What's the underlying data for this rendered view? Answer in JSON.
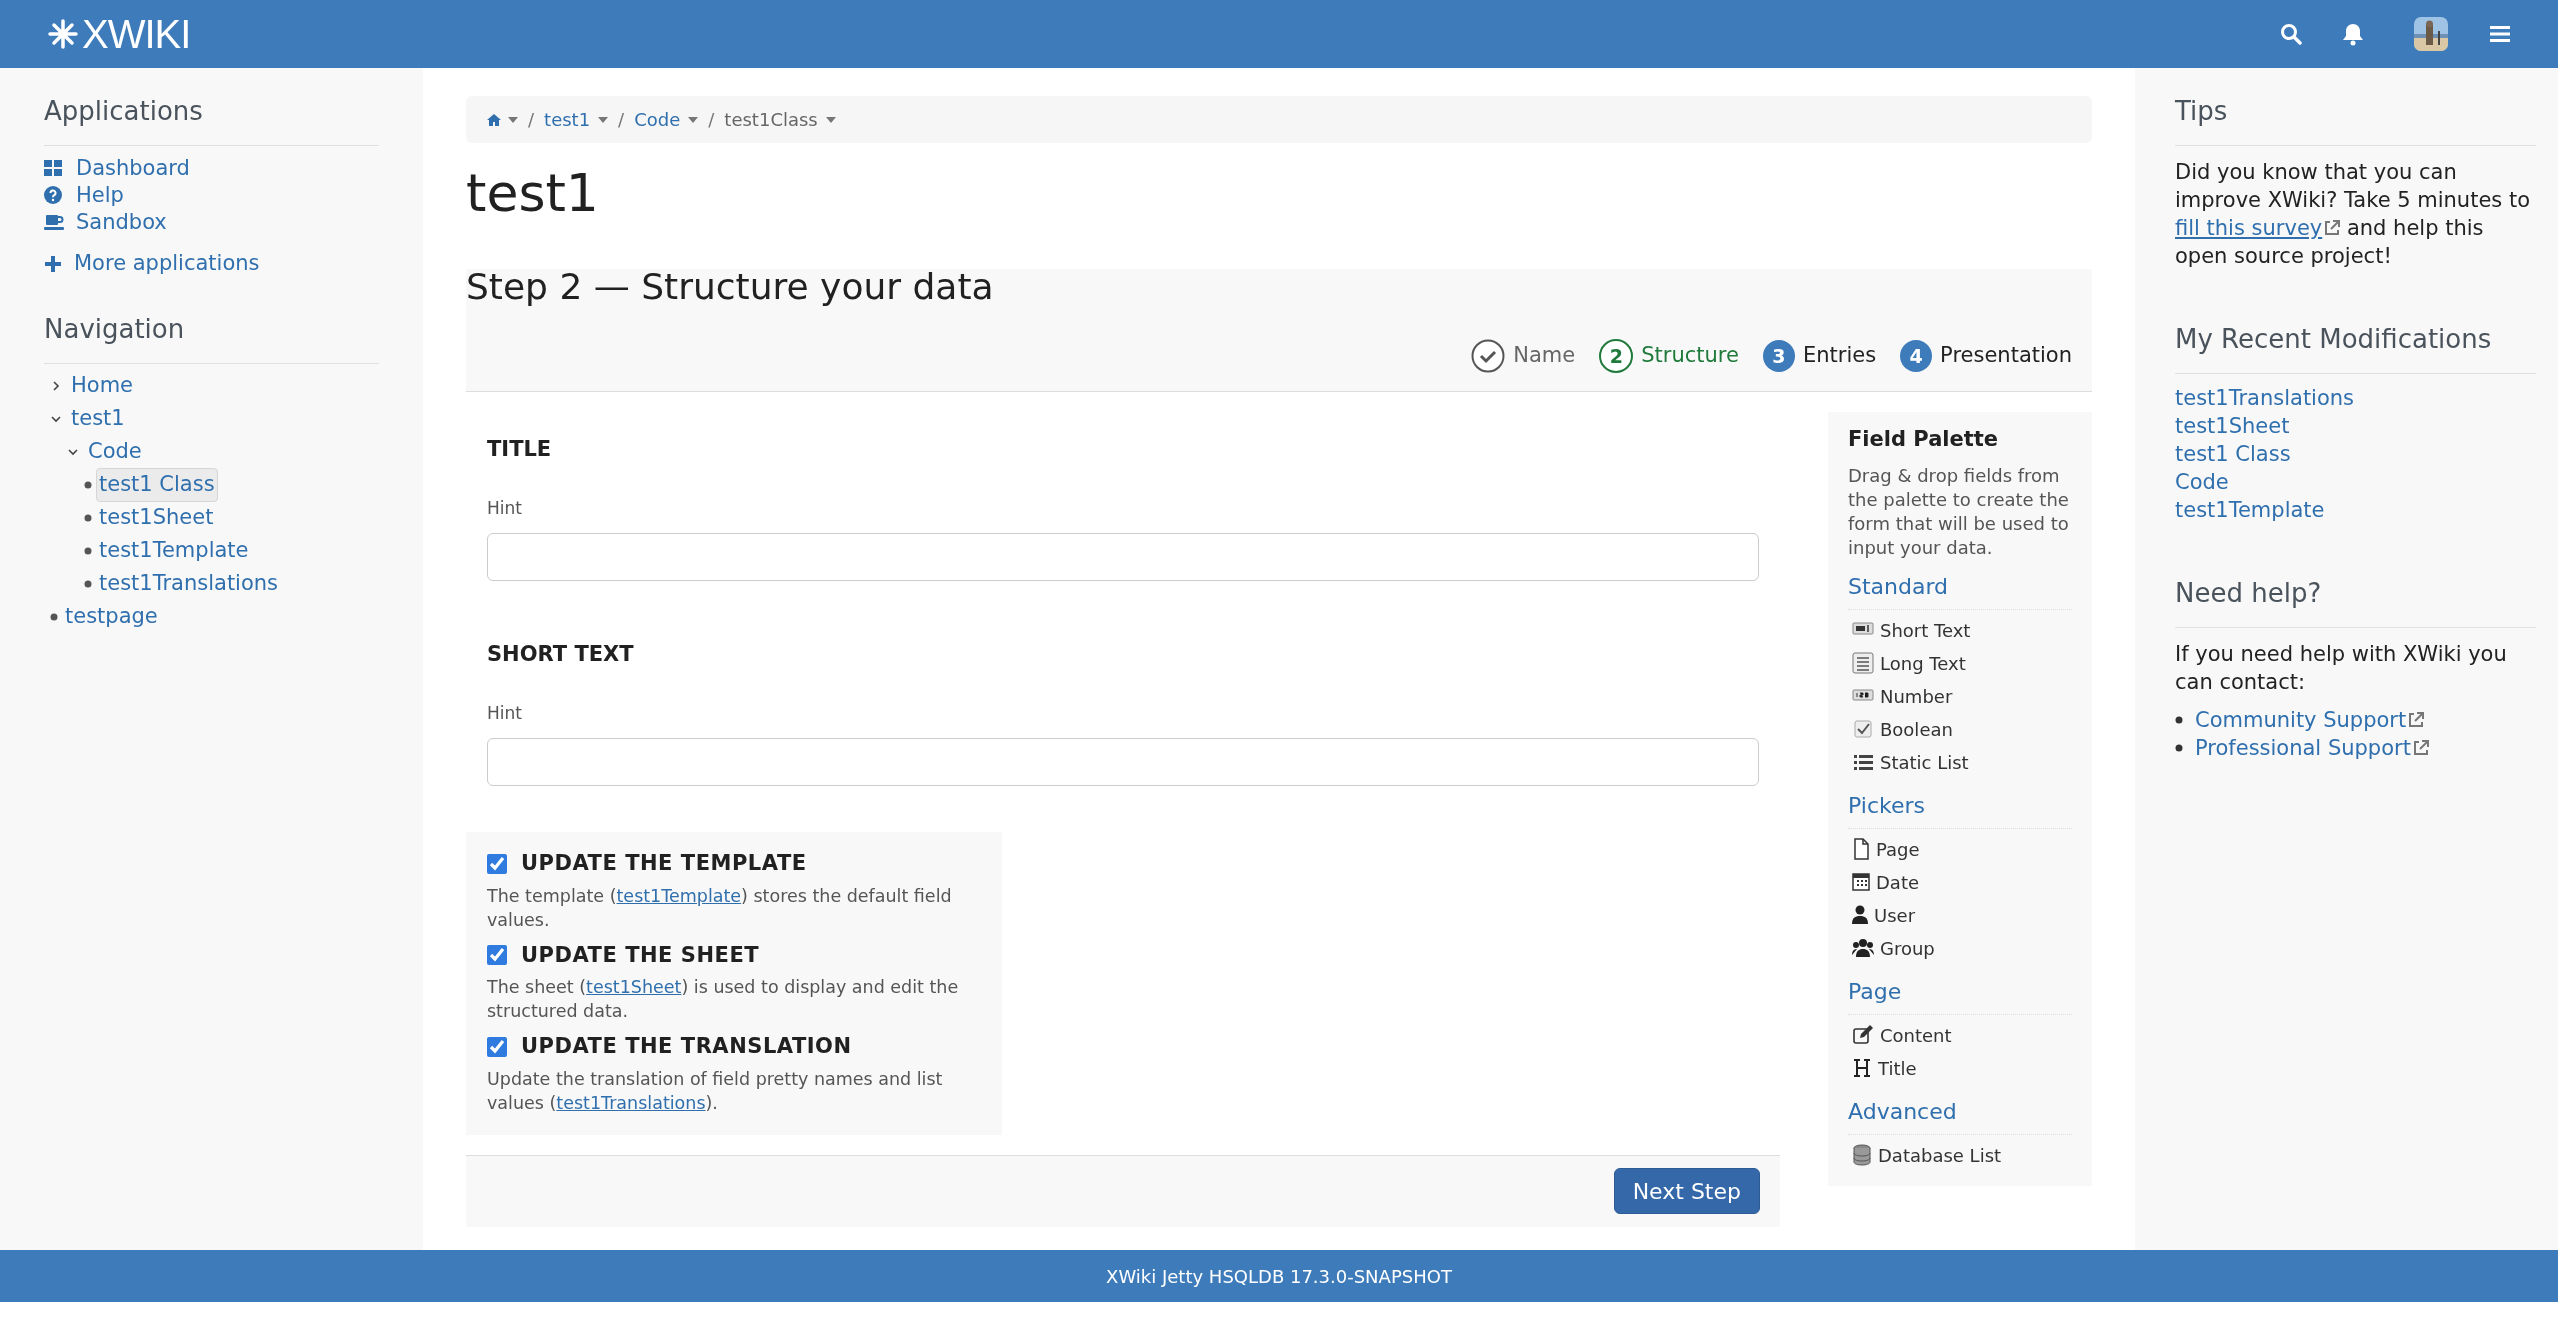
{
  "header": {
    "logo": "XWIKI"
  },
  "applications": {
    "title": "Applications",
    "items": [
      {
        "label": "Dashboard"
      },
      {
        "label": "Help"
      },
      {
        "label": "Sandbox"
      }
    ],
    "more": "More applications"
  },
  "navigation": {
    "title": "Navigation",
    "tree": [
      {
        "label": "Home",
        "expanded": false,
        "selected": false
      },
      {
        "label": "test1",
        "expanded": true,
        "selected": false,
        "children": [
          {
            "label": "Code",
            "expanded": true,
            "selected": false,
            "children": [
              {
                "label": "test1 Class",
                "selected": true
              },
              {
                "label": "test1Sheet",
                "selected": false
              },
              {
                "label": "test1Template",
                "selected": false
              },
              {
                "label": "test1Translations",
                "selected": false
              }
            ]
          }
        ]
      },
      {
        "label": "testpage",
        "selected": false
      }
    ]
  },
  "breadcrumb": [
    {
      "separator": "/",
      "label": "test1"
    },
    {
      "separator": "/",
      "label": "Code"
    },
    {
      "separator": "/",
      "label": "test1Class"
    }
  ],
  "page_title": "test1",
  "wizard": {
    "heading": "Step 2 — Structure your data",
    "steps": [
      {
        "label": "Name",
        "done": true
      },
      {
        "number": "2",
        "label": "Structure",
        "done": false,
        "selected": true
      },
      {
        "number": "3",
        "label": "Entries",
        "done": false,
        "selected": false
      },
      {
        "number": "4",
        "label": "Presentation",
        "done": false,
        "selected": false
      }
    ]
  },
  "fields": [
    {
      "label": "TITLE",
      "hint": "Hint"
    },
    {
      "label": "SHORT TEXT",
      "hint": "Hint"
    }
  ],
  "options": [
    {
      "title": "UPDATE THE TEMPLATE",
      "checked": true,
      "before": "The template (",
      "link": "test1Template",
      "after": ") stores the default field values."
    },
    {
      "title": "UPDATE THE SHEET",
      "checked": true,
      "before": "The sheet (",
      "link": "test1Sheet",
      "after": ") is used to display and edit the structured data."
    },
    {
      "title": "UPDATE THE TRANSLATION",
      "checked": true,
      "before": "Update the translation of field pretty names and list values (",
      "link": "test1Translations",
      "after": ")."
    }
  ],
  "next_button": "Next Step",
  "palette": {
    "title": "Field Palette",
    "description": "Drag & drop fields from the palette to create the form that will be used to input your data.",
    "groups": [
      {
        "title": "Standard",
        "items": [
          "Short Text",
          "Long Text",
          "Number",
          "Boolean",
          "Static List"
        ]
      },
      {
        "title": "Pickers",
        "items": [
          "Page",
          "Date",
          "User",
          "Group"
        ]
      },
      {
        "title": "Page",
        "items": [
          "Content",
          "Title"
        ]
      },
      {
        "title": "Advanced",
        "items": [
          "Database List"
        ]
      }
    ]
  },
  "tips": {
    "title": "Tips",
    "before": "Did you know that you can improve XWiki? Take 5 minutes to ",
    "link": "fill this survey",
    "after": " and help this open source project!"
  },
  "recent": {
    "title": "My Recent Modifications",
    "items": [
      "test1Translations",
      "test1Sheet",
      "test1 Class",
      "Code",
      "test1Template"
    ]
  },
  "help": {
    "title": "Need help?",
    "text": "If you need help with XWiki you can contact:",
    "links": [
      "Community Support",
      "Professional Support"
    ]
  },
  "footer": "XWiki Jetty HSQLDB 17.3.0-SNAPSHOT"
}
